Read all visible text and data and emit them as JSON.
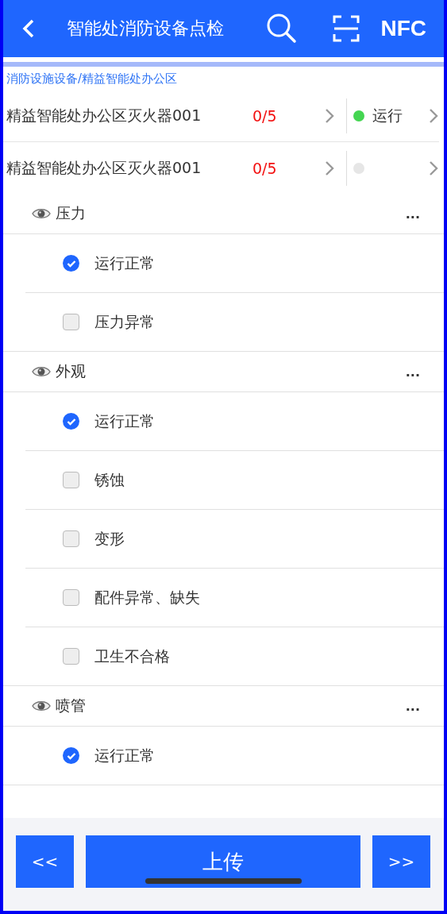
{
  "header": {
    "title": "智能处消防设备点检",
    "action": "NFC"
  },
  "breadcrumb": "消防设施设备/精益智能处办公区",
  "devices": [
    {
      "name": "精益智能处办公区灭火器001",
      "count": "0/5",
      "status": {
        "color": "#44d551",
        "label": "运行"
      }
    },
    {
      "name": "精益智能处办公区灭火器001",
      "count": "0/5",
      "status": {
        "color": "#e6e6e6"
      }
    }
  ],
  "groups": [
    {
      "title": "压力",
      "more": "...",
      "items": [
        {
          "label": "运行正常",
          "checked": true
        },
        {
          "label": "压力异常",
          "checked": false
        }
      ]
    },
    {
      "title": "外观",
      "more": "...",
      "items": [
        {
          "label": "运行正常",
          "checked": true
        },
        {
          "label": "锈蚀",
          "checked": false
        },
        {
          "label": "变形",
          "checked": false
        },
        {
          "label": "配件异常、缺失",
          "checked": false
        },
        {
          "label": "卫生不合格",
          "checked": false
        }
      ]
    },
    {
      "title": "喷管",
      "more": "...",
      "items": [
        {
          "label": "运行正常",
          "checked": true
        }
      ]
    }
  ],
  "footer": {
    "prev": "<<",
    "upload": "上传",
    "next": ">>"
  }
}
